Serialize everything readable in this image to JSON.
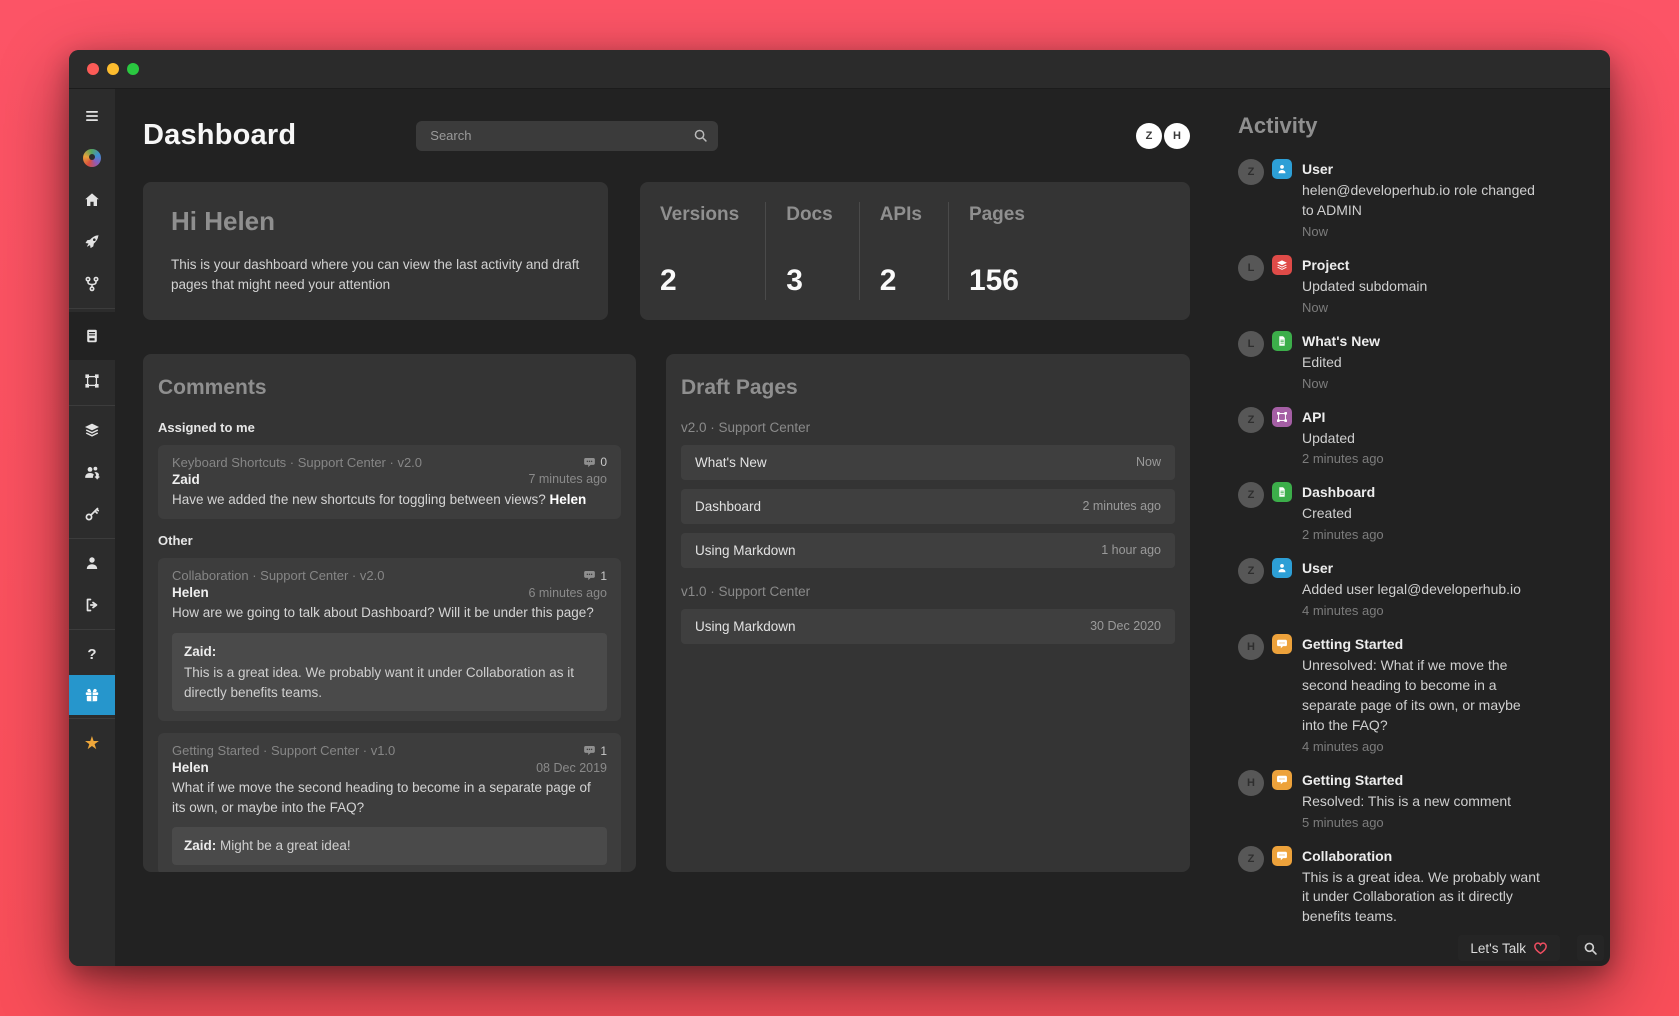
{
  "header": {
    "title": "Dashboard",
    "search_placeholder": "Search",
    "avatars": [
      "Z",
      "H"
    ]
  },
  "sidebar": {
    "icons": [
      "menu-icon",
      "logo",
      "home-icon",
      "rocket-icon",
      "git-branch-icon",
      "docs-icon",
      "artboard-icon",
      "layers-icon",
      "team-icon",
      "key-icon",
      "user-icon",
      "sign-out-icon",
      "help-icon",
      "gift-icon",
      "star-icon"
    ],
    "help_glyph": "?",
    "star_glyph": "★"
  },
  "welcome": {
    "title": "Hi Helen",
    "body": "This is your dashboard where you can view the last activity and draft pages that might need your attention"
  },
  "stats": {
    "items": [
      {
        "label": "Versions",
        "value": "2"
      },
      {
        "label": "Docs",
        "value": "3"
      },
      {
        "label": "APIs",
        "value": "2"
      },
      {
        "label": "Pages",
        "value": "156"
      }
    ]
  },
  "comments": {
    "title": "Comments",
    "sections": [
      {
        "label": "Assigned to me",
        "cards": [
          {
            "meta": "Keyboard Shortcuts · Support Center · v2.0",
            "count": "0",
            "author": "Zaid",
            "time": "7 minutes ago",
            "body": "Have we added the new shortcuts for toggling between views? ",
            "mention": "Helen"
          }
        ]
      },
      {
        "label": "Other",
        "cards": [
          {
            "meta": "Collaboration · Support Center · v2.0",
            "count": "1",
            "author": "Helen",
            "time": "6 minutes ago",
            "body": "How are we going to talk about Dashboard? Will it be under this page?",
            "reply_author": "Zaid:",
            "reply_body": "This is a great idea. We probably want it under Collaboration as it directly benefits teams."
          },
          {
            "meta": "Getting Started · Support Center · v1.0",
            "count": "1",
            "author": "Helen",
            "time": "08 Dec 2019",
            "body": "What if we move the second heading to become in a separate page of its own, or maybe into the FAQ?",
            "reply_author": "Zaid:",
            "reply_body": " Might be a great idea!"
          }
        ]
      }
    ]
  },
  "draft_pages": {
    "title": "Draft Pages",
    "groups": [
      {
        "label": "v2.0 · Support Center",
        "rows": [
          {
            "title": "What's New",
            "time": "Now"
          },
          {
            "title": "Dashboard",
            "time": "2 minutes ago"
          },
          {
            "title": "Using Markdown",
            "time": "1 hour ago"
          }
        ]
      },
      {
        "label": "v1.0 · Support Center",
        "rows": [
          {
            "title": "Using Markdown",
            "time": "30 Dec 2020"
          }
        ]
      }
    ]
  },
  "activity": {
    "title": "Activity",
    "items": [
      {
        "avatar": "Z",
        "icon": "user-icon",
        "title": "User",
        "body": "helen@developerhub.io role changed to ADMIN",
        "time": "Now"
      },
      {
        "avatar": "L",
        "icon": "layers-icon",
        "title": "Project",
        "body": "Updated subdomain",
        "time": "Now"
      },
      {
        "avatar": "L",
        "icon": "file-icon",
        "title": "What's New",
        "body": "Edited",
        "time": "Now"
      },
      {
        "avatar": "Z",
        "icon": "artboard-icon",
        "title": "API",
        "body": "Updated",
        "time": "2 minutes ago"
      },
      {
        "avatar": "Z",
        "icon": "file-icon",
        "title": "Dashboard",
        "body": "Created",
        "time": "2 minutes ago"
      },
      {
        "avatar": "Z",
        "icon": "user-icon",
        "title": "User",
        "body": "Added user legal@developerhub.io",
        "time": "4 minutes ago"
      },
      {
        "avatar": "H",
        "icon": "comment-icon",
        "title": "Getting Started",
        "body": "Unresolved: What if we move the second heading to become in a separate page of its own, or maybe into the FAQ?",
        "time": "4 minutes ago"
      },
      {
        "avatar": "H",
        "icon": "comment-icon",
        "title": "Getting Started",
        "body": "Resolved: This is a new comment",
        "time": "5 minutes ago"
      },
      {
        "avatar": "Z",
        "icon": "comment-icon",
        "title": "Collaboration",
        "body": "This is a great idea. We probably want it under Collaboration as it directly benefits teams."
      }
    ]
  },
  "widgets": {
    "chat_label": "Let's Talk"
  },
  "colors": {
    "page_background": "#fb5364",
    "window_background": "#222222",
    "card_background": "#343434",
    "sidebar_active_blue": "#2696cc",
    "star_orange": "#eda63a",
    "icon_blue": "#2d9fd6",
    "icon_red": "#df4b48",
    "icon_green": "#3cae4a",
    "icon_purple": "#a55fa5",
    "icon_orange": "#eda23b",
    "heart_red": "#ee4d60"
  }
}
